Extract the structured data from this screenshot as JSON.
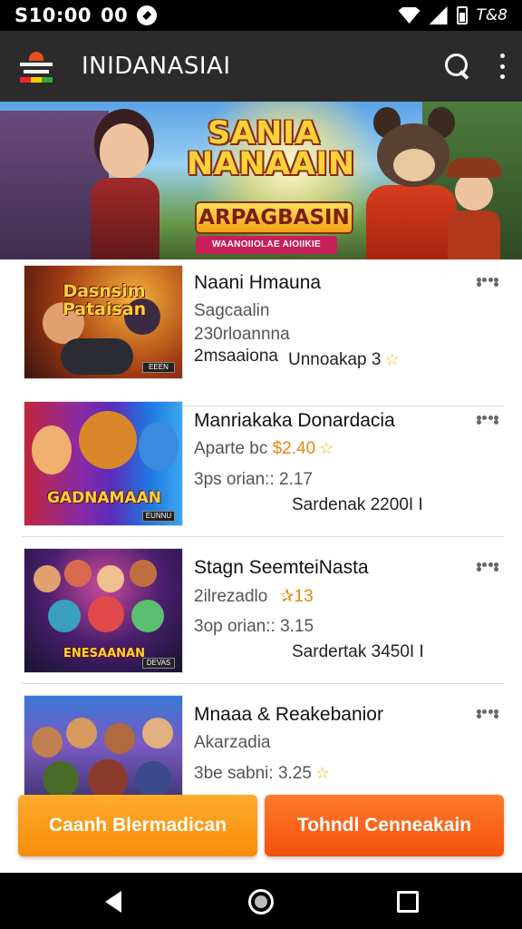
{
  "status_bar": {
    "time": "S10:00",
    "extra_text": "00",
    "battery": "T&8"
  },
  "app_bar": {
    "title": "INIDANASIAI"
  },
  "banner": {
    "title": "SANIA NANAAIN",
    "subtitle": "ARPAGBASIN",
    "tagline": "WAANOIIOLAE AIOIIKIE"
  },
  "games": [
    {
      "thumb_text": "Dasnsim Pataisan",
      "thumb_badge": "EEEN",
      "title": "Naani Hmauna",
      "line1": "Sagcaalin",
      "line2": "230rloannna",
      "line3_left": "2msaaiona",
      "line3_right": "Unnoakap 3"
    },
    {
      "thumb_text": "GADNAMAAN",
      "thumb_badge": "EUNNU",
      "title": "Manriakaka Donardacia",
      "line1_prefix": "Aparte bc",
      "line1_price": "$2.40",
      "line2": "3ps orian:: 2.17",
      "line3": "Sardenak 2200I I"
    },
    {
      "thumb_text": "ENESAANAN",
      "thumb_badge": "DEVAS",
      "title": "Stagn SeemteiNasta",
      "line1": "2ilrezadlo",
      "line1_rating": "✰13",
      "line2": "3op orian:: 3.15",
      "line3": "Sardertak 3450I I"
    },
    {
      "thumb_text": "",
      "thumb_badge": "",
      "title": "Mnaaa & Reakebanior",
      "line1": "Akarzadia",
      "line2": "3be sabni: 3.25"
    }
  ],
  "buttons": {
    "left_label": "Caanh Blermadican",
    "right_label": "Tohndl Cenneakain"
  },
  "colors": {
    "app_bar": "#2b2b2b",
    "button_left": "#f99a16",
    "button_right": "#f4621a",
    "star": "#f3b21a"
  }
}
